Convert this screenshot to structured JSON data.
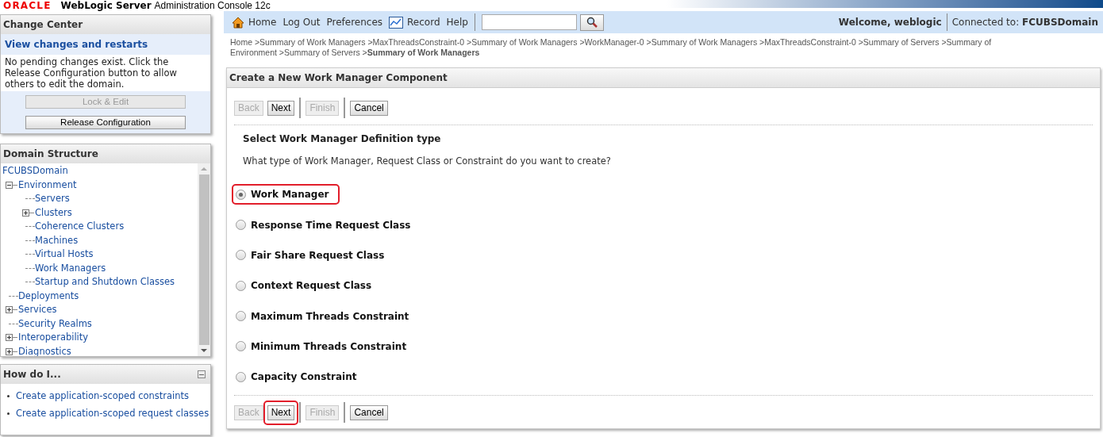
{
  "header": {
    "logo": "ORACLE",
    "product": "WebLogic Server",
    "subtitle": "Administration Console 12c"
  },
  "change_center": {
    "title": "Change Center",
    "link": "View changes and restarts",
    "message": "No pending changes exist. Click the Release Configuration button to allow others to edit the domain.",
    "buttons": [
      {
        "label": "Lock & Edit",
        "disabled": true
      },
      {
        "label": "Release Configuration",
        "disabled": false
      }
    ]
  },
  "domain_structure": {
    "title": "Domain Structure",
    "root": "FCUBSDomain",
    "tree": [
      {
        "label": "Environment",
        "kind": "folder",
        "expanded": true,
        "children": [
          {
            "label": "Servers",
            "kind": "leaf"
          },
          {
            "label": "Clusters",
            "kind": "folder",
            "expanded": false
          },
          {
            "label": "Coherence Clusters",
            "kind": "leaf"
          },
          {
            "label": "Machines",
            "kind": "leaf"
          },
          {
            "label": "Virtual Hosts",
            "kind": "leaf"
          },
          {
            "label": "Work Managers",
            "kind": "leaf"
          },
          {
            "label": "Startup and Shutdown Classes",
            "kind": "leaf"
          }
        ]
      },
      {
        "label": "Deployments",
        "kind": "leaf"
      },
      {
        "label": "Services",
        "kind": "folder",
        "expanded": false
      },
      {
        "label": "Security Realms",
        "kind": "leaf"
      },
      {
        "label": "Interoperability",
        "kind": "folder",
        "expanded": false
      },
      {
        "label": "Diagnostics",
        "kind": "folder",
        "expanded": false
      }
    ]
  },
  "how_do_i": {
    "title": "How do I...",
    "links": [
      "Create application-scoped constraints",
      "Create application-scoped request classes"
    ]
  },
  "nav": {
    "links": [
      {
        "label": "Home",
        "kind": "home"
      },
      {
        "label": "Log Out",
        "kind": "plain"
      },
      {
        "label": "Preferences",
        "kind": "plain"
      },
      {
        "label": "Record",
        "kind": "record"
      },
      {
        "label": "Help",
        "kind": "plain"
      }
    ],
    "welcome": "Welcome, weblogic",
    "connected_label": "Connected to:",
    "connected_domain": "FCUBSDomain"
  },
  "breadcrumb": "Home >Summary of Work Managers >MaxThreadsConstraint-0 >Summary of Work Managers >WorkManager-0 >Summary of Work Managers >MaxThreadsConstraint-0 >Summary of Servers >Summary of Environment >Summary of Servers >**Summary of Work Managers**",
  "wizard": {
    "title": "Create a New Work Manager Component",
    "top_buttons": [
      {
        "label": "Back",
        "disabled": true,
        "highlighted": false
      },
      {
        "label": "Next",
        "disabled": false,
        "highlighted": false
      },
      {
        "label": "Finish",
        "disabled": true,
        "highlighted": false
      },
      {
        "label": "Cancel",
        "disabled": false,
        "highlighted": false
      }
    ],
    "heading": "Select Work Manager Definition type",
    "question": "What type of Work Manager, Request Class or Constraint do you want to create?",
    "options": [
      {
        "label": "Work Manager",
        "selected": true,
        "highlighted": true
      },
      {
        "label": "Response Time Request Class",
        "selected": false,
        "highlighted": false
      },
      {
        "label": "Fair Share Request Class",
        "selected": false,
        "highlighted": false
      },
      {
        "label": "Context Request Class",
        "selected": false,
        "highlighted": false
      },
      {
        "label": "Maximum Threads Constraint",
        "selected": false,
        "highlighted": false
      },
      {
        "label": "Minimum Threads Constraint",
        "selected": false,
        "highlighted": false
      },
      {
        "label": "Capacity Constraint",
        "selected": false,
        "highlighted": false
      }
    ],
    "bottom_buttons": [
      {
        "label": "Back",
        "disabled": true,
        "highlighted": false
      },
      {
        "label": "Next",
        "disabled": false,
        "highlighted": true
      },
      {
        "label": "Finish",
        "disabled": true,
        "highlighted": false
      },
      {
        "label": "Cancel",
        "disabled": false,
        "highlighted": false
      }
    ]
  }
}
